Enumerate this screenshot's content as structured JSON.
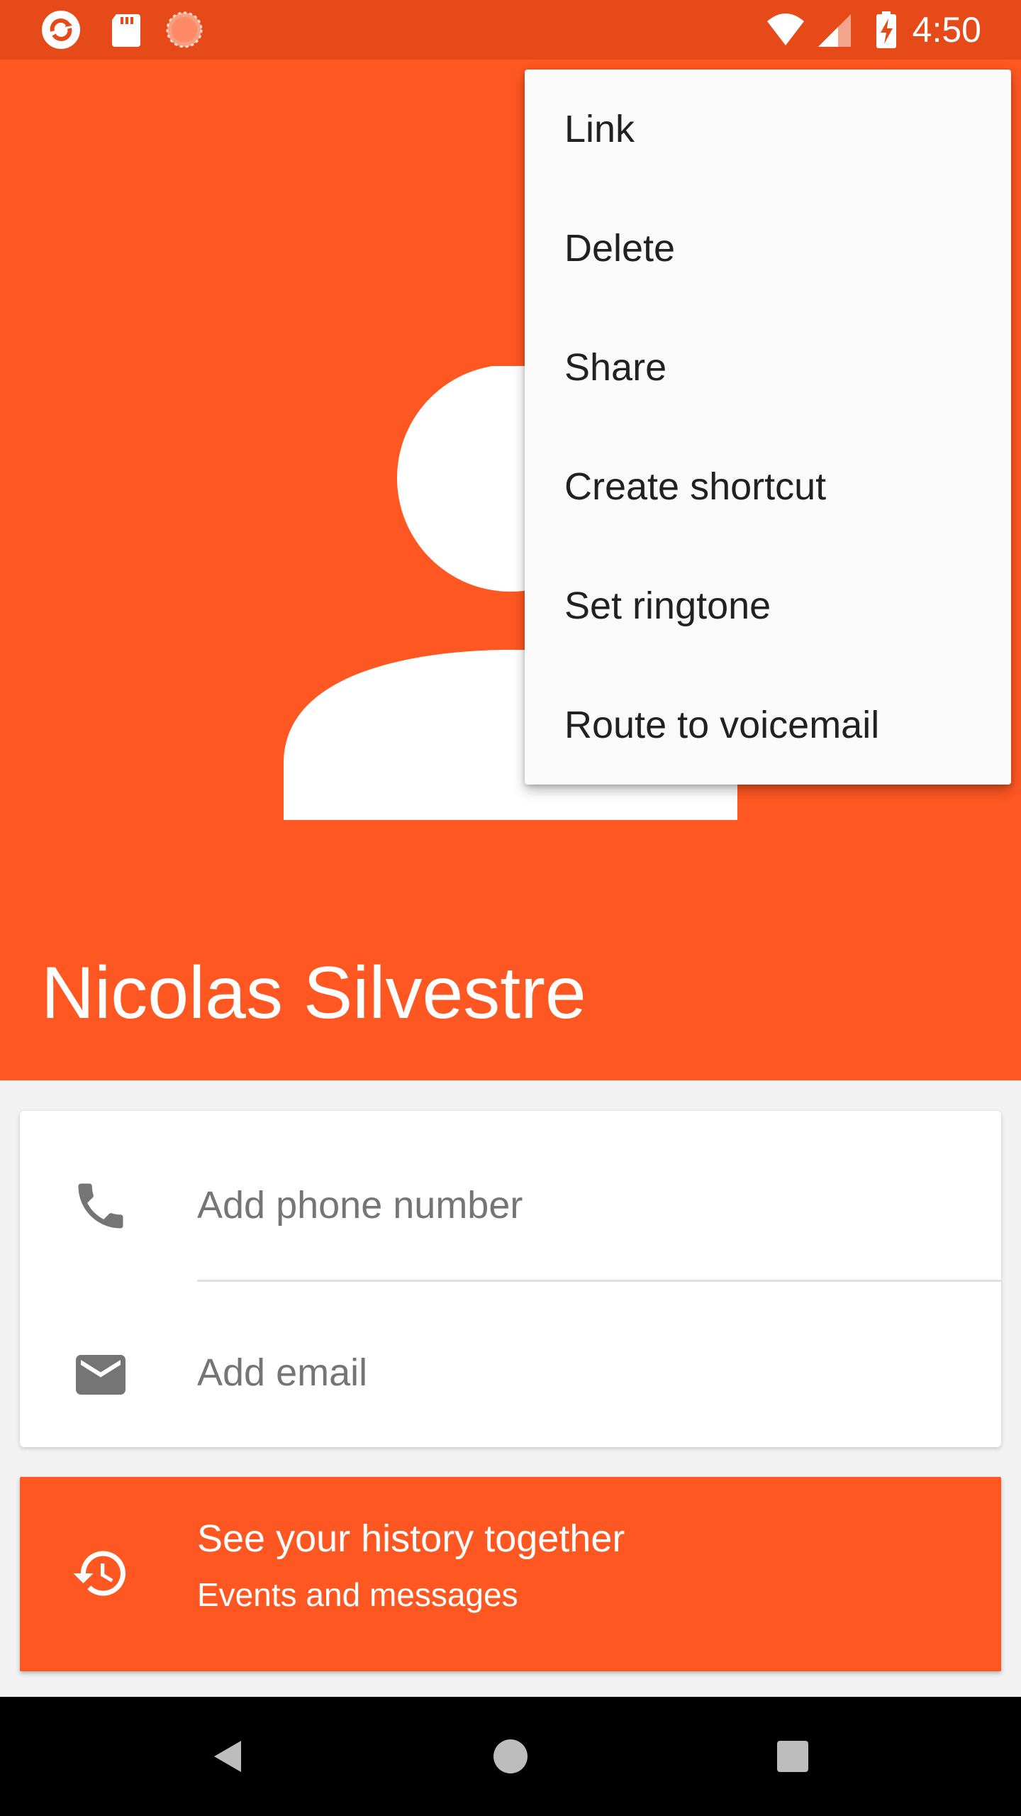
{
  "status_bar": {
    "time": "4:50",
    "icons": [
      "refresh-app-icon",
      "sd-card-icon",
      "sync-spinner-icon",
      "wifi-icon",
      "cell-signal-icon",
      "battery-charging-icon"
    ]
  },
  "contact": {
    "name": "Nicolas Silvestre",
    "accent_color": "#ff5722",
    "avatar": "person-placeholder-icon"
  },
  "info_card": {
    "phone_placeholder": "Add phone number",
    "email_placeholder": "Add email",
    "phone_icon": "phone-icon",
    "email_icon": "email-icon"
  },
  "history_card": {
    "title": "See your history together",
    "subtitle": "Events and messages",
    "icon": "history-icon"
  },
  "menu": {
    "items": [
      {
        "label": "Link"
      },
      {
        "label": "Delete"
      },
      {
        "label": "Share"
      },
      {
        "label": "Create shortcut"
      },
      {
        "label": "Set ringtone"
      },
      {
        "label": "Route to voicemail"
      }
    ]
  },
  "nav_bar": {
    "icons": [
      "back-icon",
      "home-icon",
      "recents-icon"
    ]
  }
}
